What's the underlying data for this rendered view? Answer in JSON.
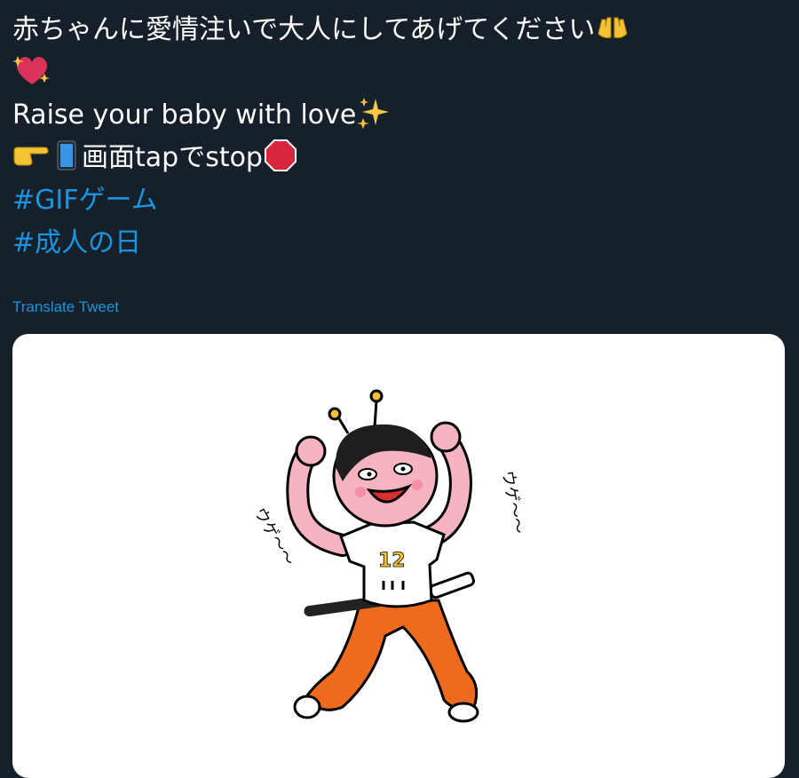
{
  "tweet": {
    "line1": "赤ちゃんに愛情注いで大人にしてあげてください",
    "line1_emoji": "👐",
    "line2_emoji": "💖",
    "line3": "Raise your baby with love",
    "line3_emoji": "✨",
    "line4_emoji_point": "👉",
    "line4_emoji_phone": "📱",
    "line4_text": "画面tapでstop",
    "line4_emoji_stop": "🛑",
    "hashtag1": "#GIFゲーム",
    "hashtag2": "#成人の日"
  },
  "translate_label": "Translate Tweet",
  "media": {
    "shirt_number": "12",
    "caption_left": "ウゲ〜〜",
    "caption_right": "ウゲ〜〜"
  },
  "colors": {
    "background": "#15202b",
    "link": "#1b95e0",
    "text": "#ffffff"
  }
}
